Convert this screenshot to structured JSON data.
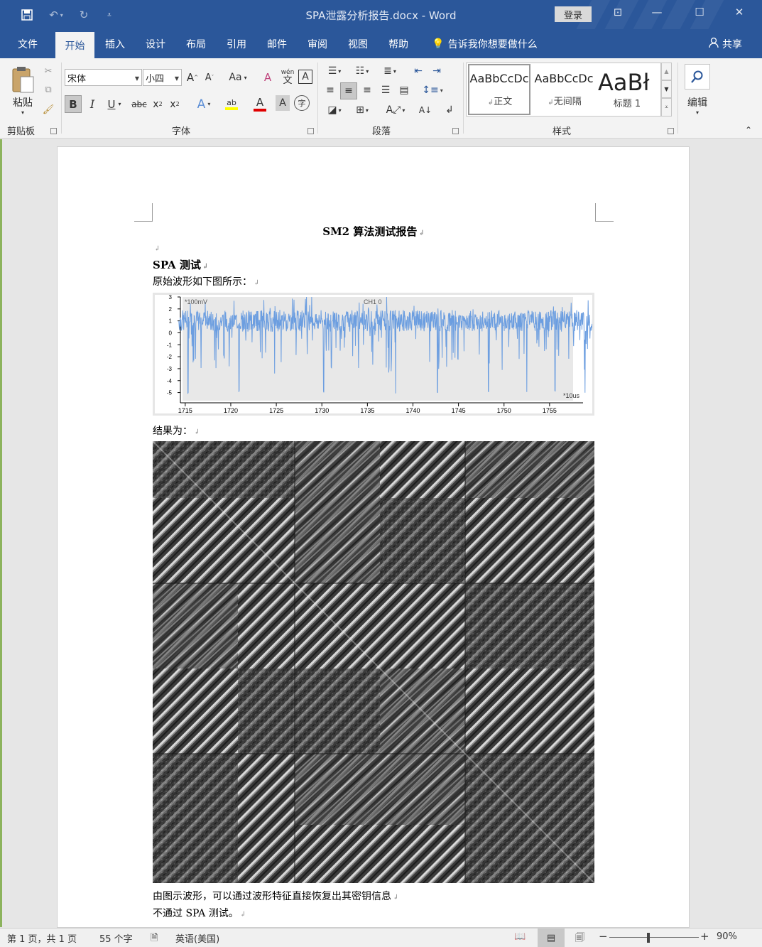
{
  "window": {
    "title": "SPA泄露分析报告.docx  -  Word",
    "login": "登录"
  },
  "tabs": [
    "文件",
    "开始",
    "插入",
    "设计",
    "布局",
    "引用",
    "邮件",
    "审阅",
    "视图",
    "帮助"
  ],
  "tell_me": "告诉我你想要做什么",
  "share": "共享",
  "ribbon": {
    "paste_label": "粘贴",
    "font_name": "宋体",
    "font_size": "小四",
    "change_case": "Aa",
    "grow_font": "A",
    "shrink_font": "A",
    "bold": "B",
    "italic": "I",
    "underline": "U",
    "strike": "abc",
    "subscript": "x",
    "superscript": "x",
    "styles": [
      {
        "sample": "AaBbCcDc",
        "name": "正文"
      },
      {
        "sample": "AaBbCcDc",
        "name": "无间隔"
      },
      {
        "sample": "AaBł",
        "name": "标题 1"
      }
    ],
    "edit_label": "编辑",
    "groups": {
      "clipboard": "剪贴板",
      "font": "字体",
      "paragraph": "段落",
      "styles": "样式"
    }
  },
  "document": {
    "title": "SM2 算法测试报告",
    "heading": "SPA 测试",
    "intro": "原始波形如下图所示：",
    "result_label": "结果为：",
    "conclusion1": "由图示波形，可以通过波形特征直接恢复出其密钥信息",
    "conclusion2": "不通过 SPA 测试。"
  },
  "chart_data": {
    "type": "line",
    "annotations": [
      "*100mV",
      "CH1 0",
      "*10us"
    ],
    "x_ticks": [
      1715,
      1720,
      1725,
      1730,
      1735,
      1740,
      1745,
      1750,
      1755
    ],
    "y_ticks": [
      3,
      2,
      1,
      0,
      -1,
      -2,
      -3,
      -4,
      -5
    ],
    "xlim": [
      1714,
      1760
    ],
    "ylim": [
      -5.5,
      3
    ],
    "series_color": "#6c9ee0",
    "baseline_level": 1.0,
    "deep_spikes_x": [
      1715.3,
      1720.9,
      1730.2,
      1738.1,
      1742.7,
      1748.3,
      1752.5,
      1755.6,
      1758.9
    ]
  },
  "status": {
    "page": "第 1 页，共 1 页",
    "words": "55 个字",
    "language": "英语(美国)",
    "zoom": "90%"
  }
}
